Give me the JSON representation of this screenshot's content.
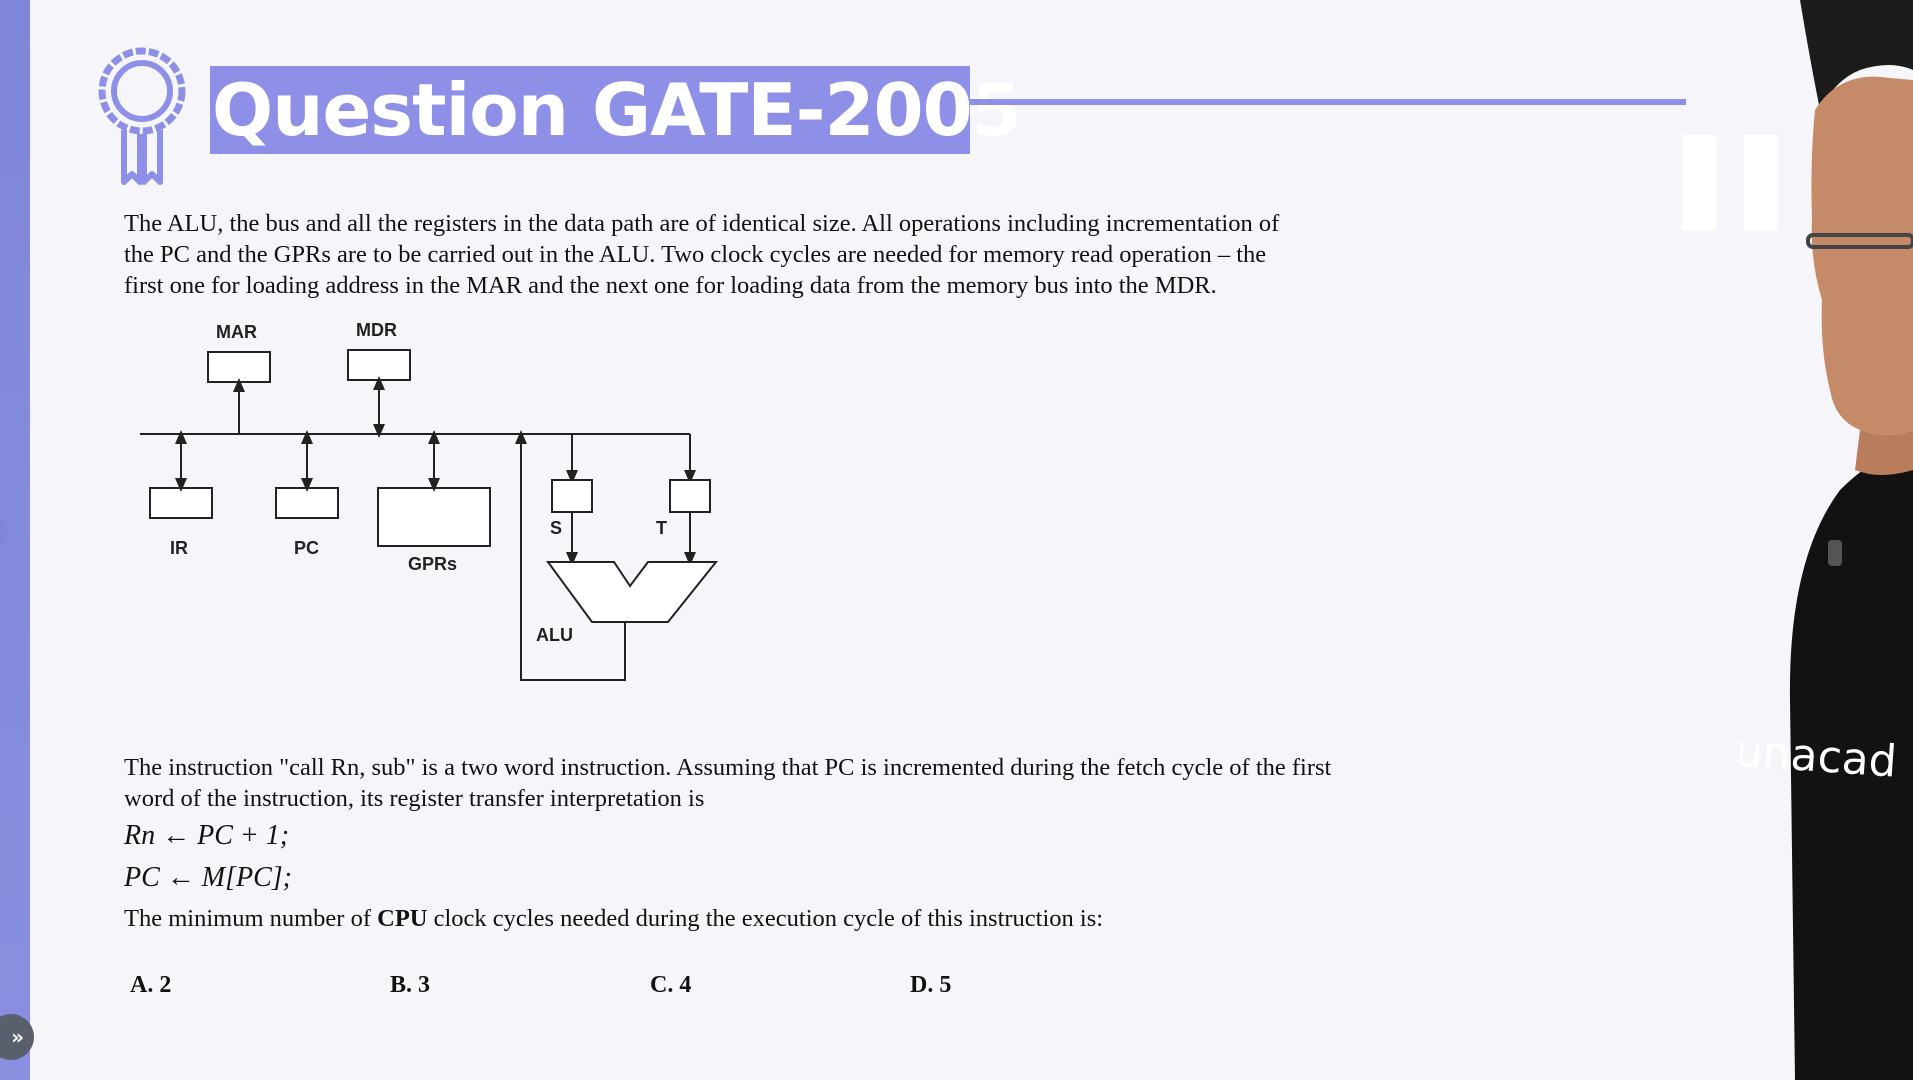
{
  "title": "Question GATE-2005",
  "paragraph1": [
    "The ALU, the bus and all the registers in the data path are of identical size. All operations including incrementation of",
    "the PC and the GPRs are to be carried out in the ALU. Two clock cycles are needed for memory read operation – the",
    "first one for loading address in the MAR and the next one for loading data from the memory bus into the MDR."
  ],
  "diagram": {
    "labels": {
      "mar": "MAR",
      "mdr": "MDR",
      "ir": "IR",
      "pc": "PC",
      "gprs": "GPRs",
      "s": "S",
      "t": "T",
      "alu": "ALU"
    }
  },
  "paragraph2": [
    "The instruction \"call Rn, sub\" is a two word instruction. Assuming that PC is incremented during the fetch cycle of the first",
    "word of the instruction, its register transfer interpretation is"
  ],
  "rtl": [
    "Rn ← PC + 1;",
    "PC ← M[PC];"
  ],
  "question": {
    "pre": "The minimum number of ",
    "bold": "CPU",
    "post": " clock cycles needed during the execution cycle of this instruction is:"
  },
  "options": [
    "A.  2",
    "B.  3",
    "C.  4",
    "D.  5"
  ],
  "watermark": "unacad",
  "colors": {
    "accent": "#8d90e6",
    "sidebar": "#7f85d8",
    "background": "#f6f6fa"
  },
  "icons": {
    "badge": "award-ribbon-icon",
    "expand": "double-chevron-right-icon"
  }
}
